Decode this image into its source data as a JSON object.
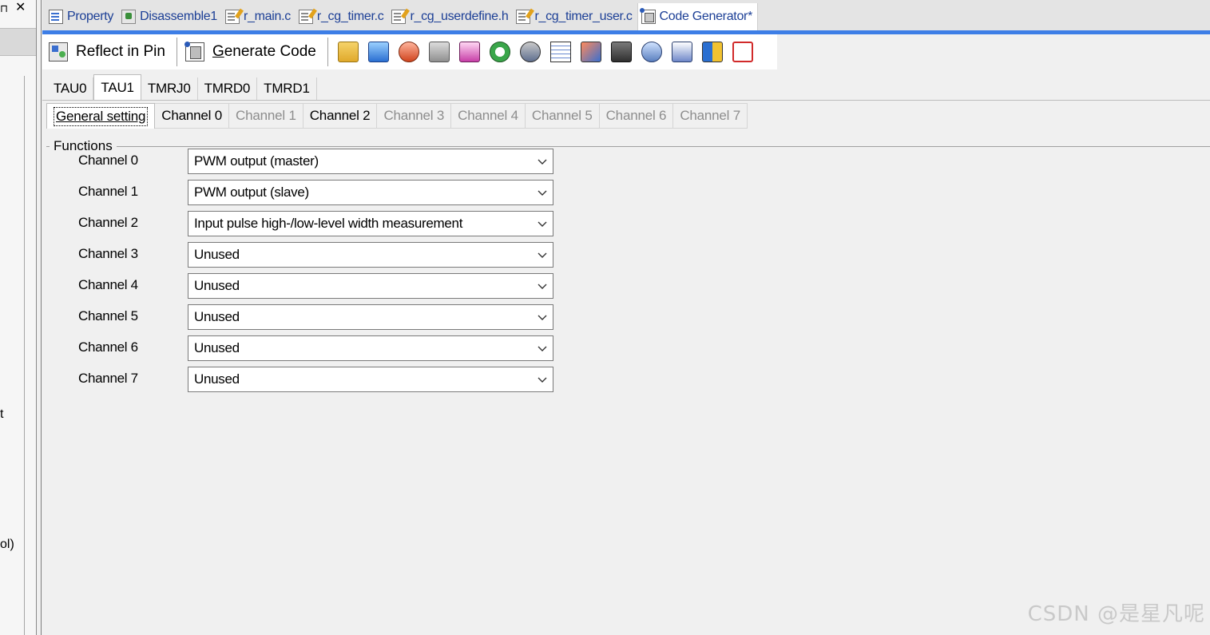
{
  "left_panel": {
    "pin_glyph": "⊓",
    "close_glyph": "✕",
    "fragment_1": "t",
    "fragment_2": "ol)"
  },
  "doc_tabs": [
    {
      "label": "Property",
      "icon": "property-icon"
    },
    {
      "label": "Disassemble1",
      "icon": "disassemble-icon"
    },
    {
      "label": "r_main.c",
      "icon": "c-file-icon"
    },
    {
      "label": "r_cg_timer.c",
      "icon": "c-file-icon"
    },
    {
      "label": "r_cg_userdefine.h",
      "icon": "h-file-icon"
    },
    {
      "label": "r_cg_timer_user.c",
      "icon": "c-file-icon"
    },
    {
      "label": "Code Generator*",
      "icon": "code-generator-icon",
      "active": true
    }
  ],
  "toolbar": {
    "reflect_label": "Reflect in Pin",
    "generate_underline": "G",
    "generate_rest": "enerate Code",
    "tools": [
      "clock-generator-icon",
      "port-icon",
      "interrupt-icon",
      "serial-icon",
      "a-d-converter-icon",
      "timer-icon",
      "watchdog-icon",
      "lcd-icon",
      "comparator-icon",
      "dtc-icon",
      "sound-icon",
      "pwm-icon",
      "elc-icon",
      "battery-icon"
    ]
  },
  "peripheral_tabs": [
    "TAU0",
    "TAU1",
    "TMRJ0",
    "TMRD0",
    "TMRD1"
  ],
  "peripheral_active": "TAU1",
  "channel_tabs": [
    {
      "label": "General setting",
      "state": "active"
    },
    {
      "label": "Channel 0",
      "state": "enabled"
    },
    {
      "label": "Channel 1",
      "state": "disabled"
    },
    {
      "label": "Channel 2",
      "state": "enabled"
    },
    {
      "label": "Channel 3",
      "state": "disabled"
    },
    {
      "label": "Channel 4",
      "state": "disabled"
    },
    {
      "label": "Channel 5",
      "state": "disabled"
    },
    {
      "label": "Channel 6",
      "state": "disabled"
    },
    {
      "label": "Channel 7",
      "state": "disabled"
    }
  ],
  "functions": {
    "group_title": "Functions",
    "rows": [
      {
        "label": "Channel 0",
        "value": "PWM output (master)"
      },
      {
        "label": "Channel 1",
        "value": "PWM output (slave)"
      },
      {
        "label": "Channel 2",
        "value": "Input pulse high-/low-level width measurement"
      },
      {
        "label": "Channel 3",
        "value": "Unused"
      },
      {
        "label": "Channel 4",
        "value": "Unused"
      },
      {
        "label": "Channel 5",
        "value": "Unused"
      },
      {
        "label": "Channel 6",
        "value": "Unused"
      },
      {
        "label": "Channel 7",
        "value": "Unused"
      }
    ]
  },
  "watermark": "CSDN @是星凡呢",
  "colors": {
    "accent": "#3d7ee6",
    "tab_text": "#1c3f96",
    "disabled_text": "#8d8d8d"
  }
}
